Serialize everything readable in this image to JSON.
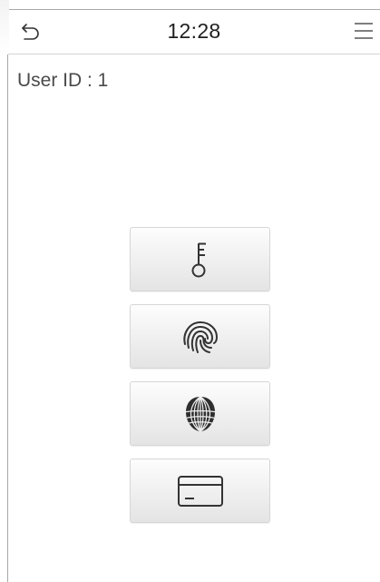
{
  "header": {
    "time": "12:28",
    "back_icon": "back-arrow-icon",
    "menu_icon": "hamburger-menu-icon"
  },
  "user": {
    "id_label": "User ID : 1"
  },
  "verification_methods": [
    {
      "name": "password",
      "icon": "key-icon"
    },
    {
      "name": "fingerprint",
      "icon": "fingerprint-icon"
    },
    {
      "name": "face",
      "icon": "face-icon"
    },
    {
      "name": "card",
      "icon": "card-icon"
    }
  ],
  "colors": {
    "icon_stroke": "#333333",
    "button_gradient_top": "#fdfdfd",
    "button_gradient_bottom": "#e4e4e4",
    "frame_border": "#a8a8a8"
  }
}
